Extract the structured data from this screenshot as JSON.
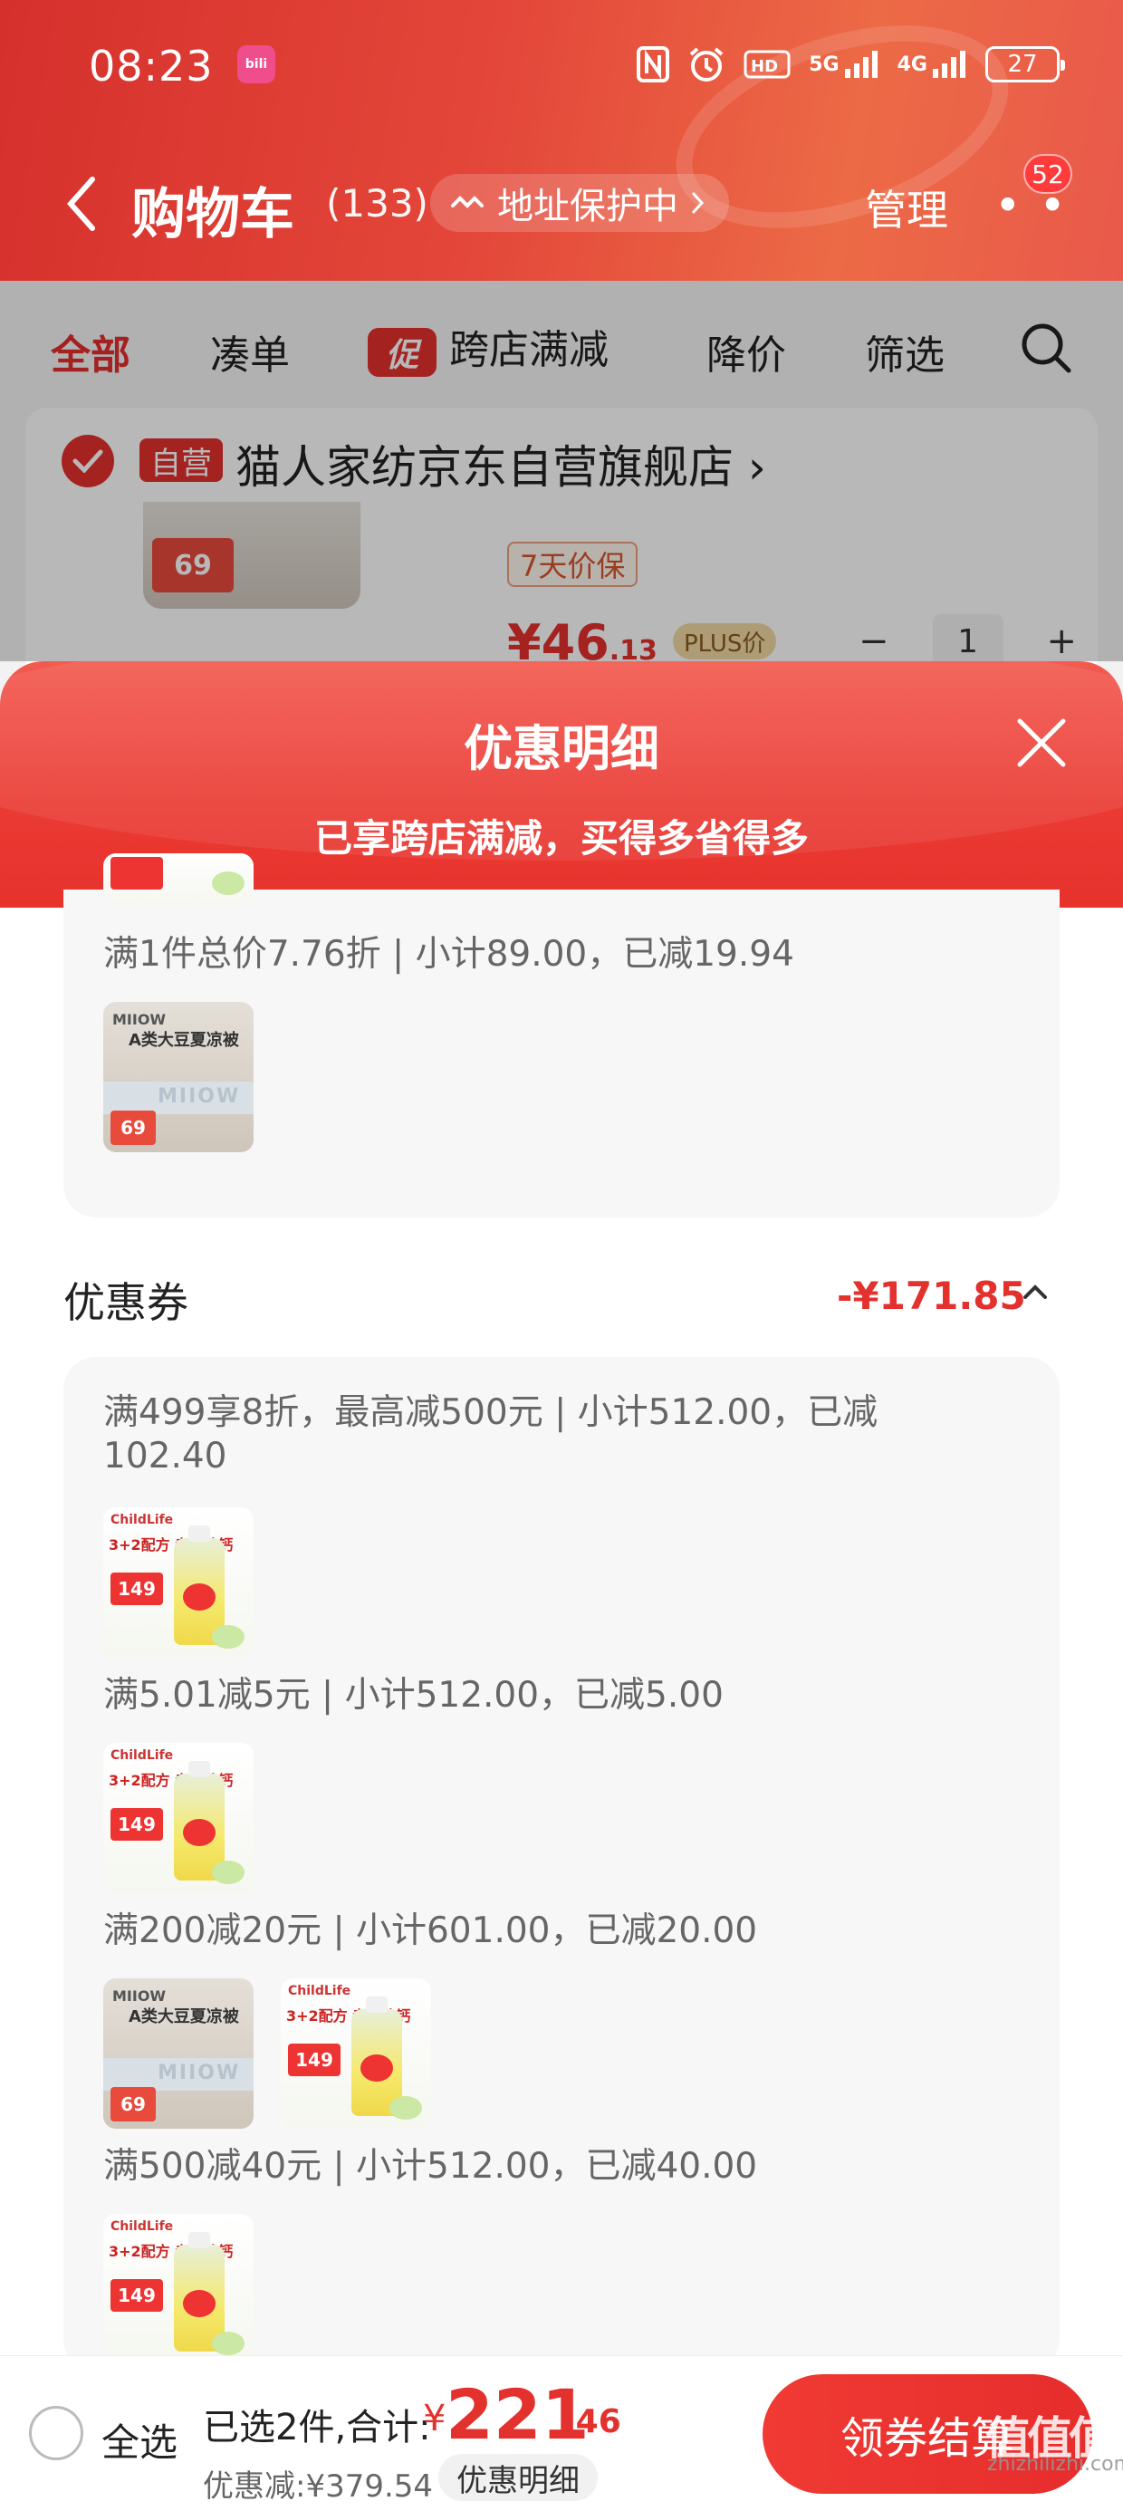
{
  "status_bar": {
    "time": "08:23",
    "app_badge": "bilibili",
    "network_1": "5G",
    "network_2": "4G",
    "hd_label": "HD",
    "battery": "27"
  },
  "navbar": {
    "back_icon": "chevron-left-icon",
    "title": "购物车",
    "count": "(133)",
    "address_protect": "地址保护中",
    "manage": "管理",
    "message_badge": "52"
  },
  "filter_tabs": [
    {
      "label": "全部",
      "active": true
    },
    {
      "label": "凑单",
      "active": false
    },
    {
      "label": "跨店满减",
      "active": false,
      "tag": "促"
    },
    {
      "label": "降价",
      "active": false
    },
    {
      "label": "筛选",
      "active": false
    }
  ],
  "store": {
    "self_tag": "自营",
    "name": "猫人家纺京东自营旗舰店",
    "thumb_price": "69",
    "price_guard": "7天价保",
    "price_int": "¥46",
    "price_dec": ".13",
    "plus_tag": "PLUS价",
    "quantity": "1"
  },
  "sheet": {
    "title": "优惠明细",
    "subtitle": "已享跨店满减，买得多省得多",
    "card1_rule": "满1件总价7.76折 | 小计89.00，已减19.94",
    "coupon_section_title": "优惠券",
    "coupon_section_amount": "-¥171.85",
    "coupon_rules": [
      "满499享8折，最高减500元 | 小计512.00，已减102.40",
      "满5.01减5元 | 小计512.00，已减5.00",
      "满200减20元 | 小计601.00，已减20.00",
      "满500减40元 | 小计512.00，已减40.00"
    ],
    "thumb_texts": {
      "towel_logo": "MIIOW",
      "towel_headline": "A类大豆夏凉被",
      "towel_price": "69",
      "bottle_brand": "ChildLife",
      "bottle_head": "3+2配方 专业补钙",
      "bottle_price": "149"
    }
  },
  "bottom_bar": {
    "select_all": "全选",
    "selected": "已选2件,合计:",
    "currency": "¥",
    "total_int": "221",
    "total_dec": ".46",
    "discount": "优惠减:¥379.54",
    "detail_button": "优惠明细",
    "checkout_button": "领券结算"
  },
  "watermark": "zhizhilizhi.com",
  "colors": {
    "accent_red": "#e3312d",
    "header_gradient_start": "#d6302c",
    "header_gradient_end": "#ec6a46"
  }
}
